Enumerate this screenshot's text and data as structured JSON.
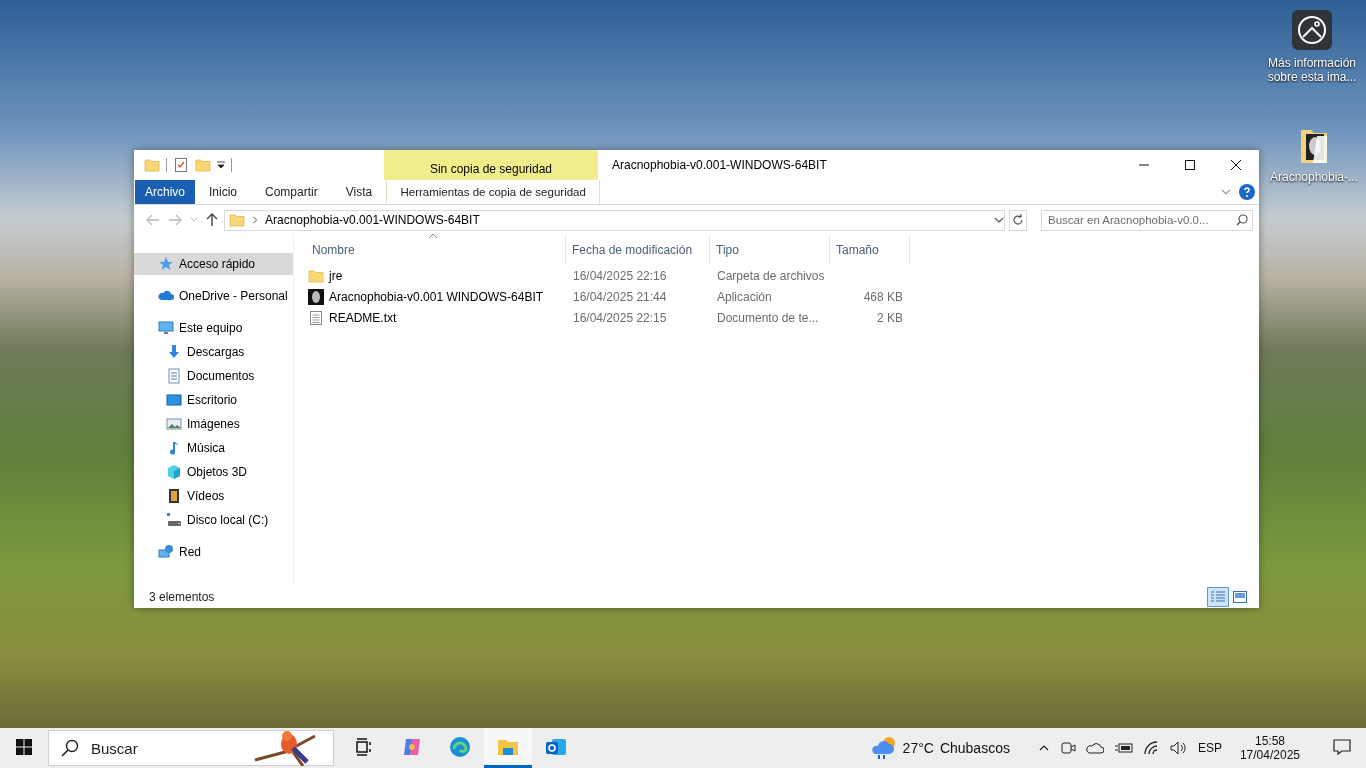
{
  "desktop": {
    "info_widget": {
      "label": "Más información sobre esta ima..."
    },
    "icons": [
      {
        "label": "Aracnophobia-..."
      }
    ]
  },
  "window": {
    "title": "Aracnophobia-v0.001-WINDOWS-64BIT",
    "context_group": "Sin copia de seguridad",
    "ribbon_tabs": [
      {
        "label": "Archivo",
        "kind": "file"
      },
      {
        "label": "Inicio",
        "kind": "tab"
      },
      {
        "label": "Compartir",
        "kind": "tab"
      },
      {
        "label": "Vista",
        "kind": "tab"
      },
      {
        "label": "Herramientas de copia de seguridad",
        "kind": "context"
      }
    ],
    "address": {
      "path": "Aracnophobia-v0.001-WINDOWS-64BIT"
    },
    "search": {
      "placeholder": "Buscar en Aracnophobia-v0.0..."
    },
    "nav_pane": [
      {
        "label": "Acceso rápido",
        "kind": "star",
        "selected": true
      },
      {
        "label": "OneDrive - Personal",
        "kind": "cloud",
        "selected": false
      },
      {
        "label": "Este equipo",
        "kind": "pc",
        "selected": false,
        "children": [
          {
            "label": "Descargas",
            "kind": "download",
            "selected": false
          },
          {
            "label": "Documentos",
            "kind": "document",
            "selected": false
          },
          {
            "label": "Escritorio",
            "kind": "desktop",
            "selected": false
          },
          {
            "label": "Imágenes",
            "kind": "image",
            "selected": false
          },
          {
            "label": "Música",
            "kind": "music",
            "selected": false
          },
          {
            "label": "Objetos 3D",
            "kind": "cube",
            "selected": false
          },
          {
            "label": "Vídeos",
            "kind": "video",
            "selected": false
          },
          {
            "label": "Disco local (C:)",
            "kind": "disk",
            "selected": false
          }
        ]
      },
      {
        "label": "Red",
        "kind": "network",
        "selected": false
      }
    ],
    "columns": [
      {
        "label": "Nombre",
        "sorted": true
      },
      {
        "label": "Fecha de modificación",
        "sorted": false
      },
      {
        "label": "Tipo",
        "sorted": false
      },
      {
        "label": "Tamaño",
        "sorted": false
      }
    ],
    "files": [
      {
        "name": "jre",
        "modified": "16/04/2025 22:16",
        "type": "Carpeta de archivos",
        "kind": "folder"
      },
      {
        "name": "Aracnophobia-v0.001 WINDOWS-64BIT",
        "modified": "16/04/2025 21:44",
        "type": "Aplicación",
        "size": "468 KB",
        "kind": "app"
      },
      {
        "name": "README.txt",
        "modified": "16/04/2025 22:15",
        "type": "Documento de te...",
        "size": "2 KB",
        "kind": "text"
      }
    ],
    "status_bar": {
      "count": "3 elementos",
      "views": [
        {
          "kind": "details",
          "selected": true
        },
        {
          "kind": "tiles",
          "selected": false
        }
      ]
    }
  },
  "taskbar": {
    "search_placeholder": "Buscar",
    "apps": [
      {
        "kind": "taskview",
        "selected": false
      },
      {
        "kind": "copilot",
        "selected": false
      },
      {
        "kind": "edge",
        "selected": false
      },
      {
        "kind": "explorer",
        "selected": true
      },
      {
        "kind": "outlook",
        "selected": false
      }
    ],
    "weather": {
      "temp": "27°C",
      "condition": "Chubascos"
    },
    "language": "ESP",
    "time": "15:58",
    "date": "17/04/2025"
  }
}
